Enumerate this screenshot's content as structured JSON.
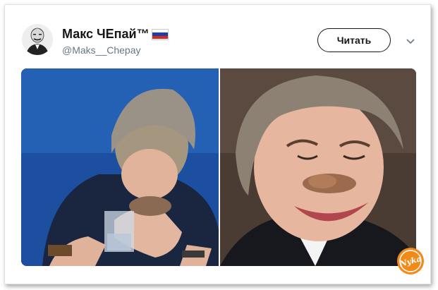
{
  "tweet": {
    "display_name": "Макс ЧЕпай™",
    "handle": "@Maks__Chepay",
    "follow_label": "Читать",
    "flag_icon": "russian-flag-icon",
    "menu_icon": "chevron-down-icon"
  },
  "media": {
    "left_photo": "woman-eating-biscuit-photo",
    "right_photo": "smiling-woman-with-biscuit-moustache-photo"
  },
  "watermark": {
    "text": "Nyka"
  },
  "colors": {
    "text_primary": "#14171a",
    "text_secondary": "#657786",
    "watermark_orange": "#f28a1a",
    "background_blue": "#1d4fa0"
  }
}
